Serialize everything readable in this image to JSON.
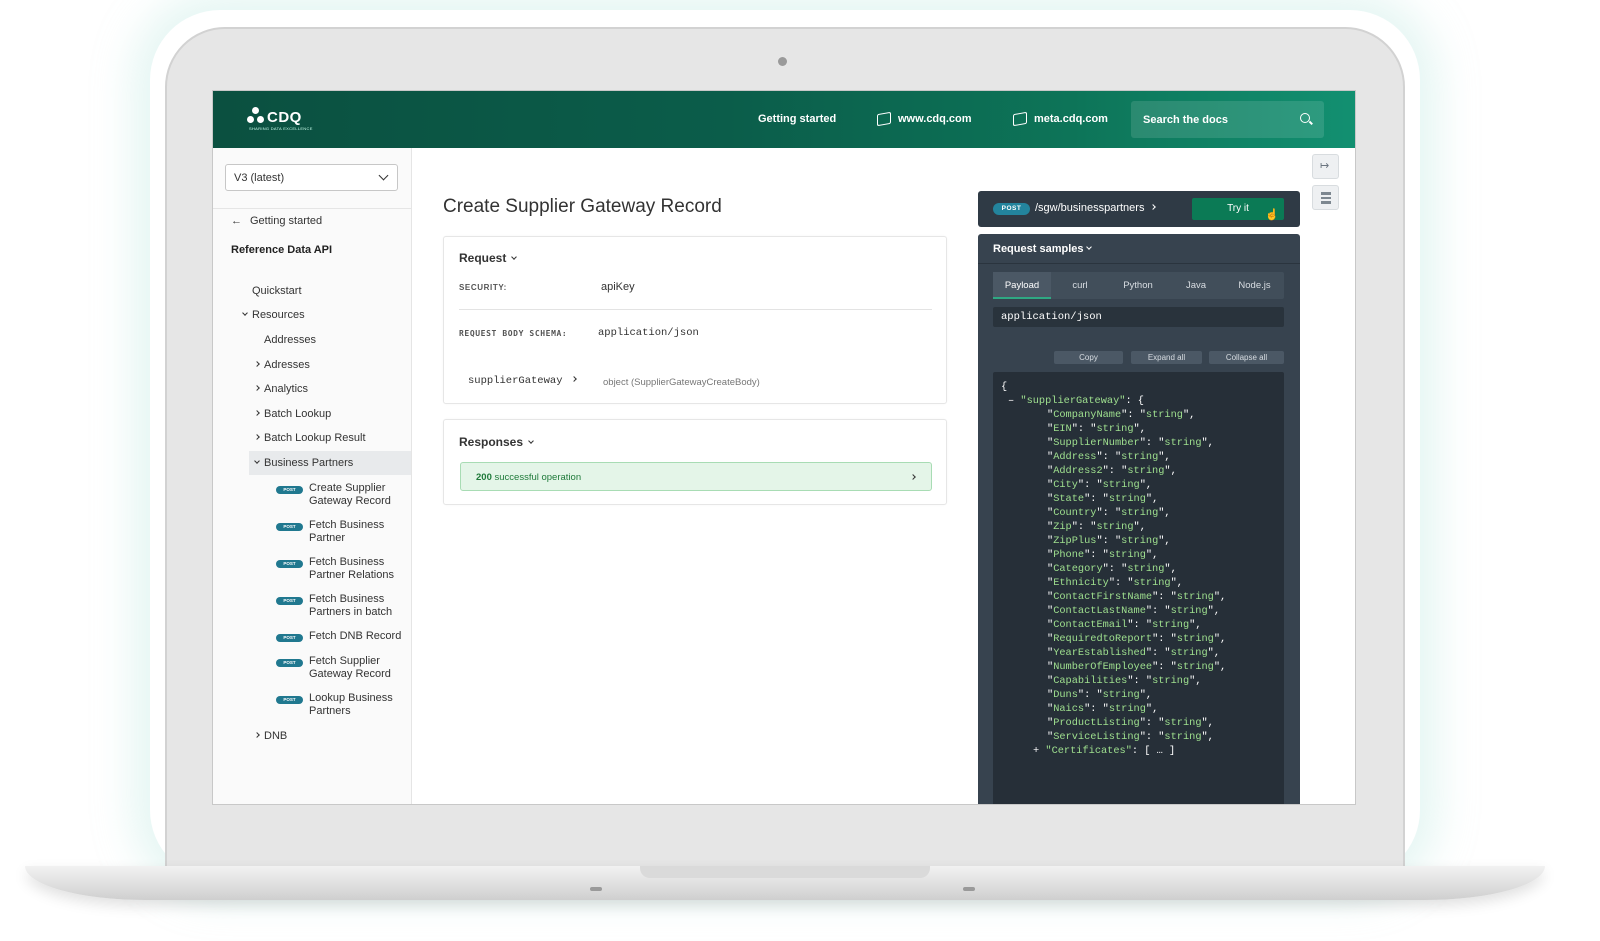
{
  "header": {
    "logo_text": "CDQ",
    "logo_tagline": "SHARING DATA EXCELLENCE",
    "nav": [
      "Getting started",
      "www.cdq.com",
      "meta.cdq.com"
    ],
    "search_placeholder": "Search the docs"
  },
  "sidebar": {
    "version": "V3 (latest)",
    "back_link": "Getting started",
    "section_title": "Reference Data API",
    "items": [
      "Quickstart",
      "Resources",
      "Addresses",
      "Adresses",
      "Analytics",
      "Batch Lookup",
      "Batch Lookup Result",
      "Business Partners",
      "DNB"
    ],
    "operations": [
      {
        "method": "POST",
        "label": "Create Supplier Gateway Record"
      },
      {
        "method": "POST",
        "label": "Fetch Business Partner"
      },
      {
        "method": "POST",
        "label": "Fetch Business Partner Relations"
      },
      {
        "method": "POST",
        "label": "Fetch Business Partners in batch"
      },
      {
        "method": "POST",
        "label": "Fetch DNB Record"
      },
      {
        "method": "POST",
        "label": "Fetch Supplier Gateway Record"
      },
      {
        "method": "POST",
        "label": "Lookup Business Partners"
      }
    ]
  },
  "main": {
    "title": "Create Supplier Gateway Record",
    "request": {
      "heading": "Request",
      "security_label": "SECURITY:",
      "security_value": "apiKey",
      "schema_label": "REQUEST BODY SCHEMA:",
      "schema_value": "application/json",
      "field_name": "supplierGateway",
      "field_type": "object (SupplierGatewayCreateBody)"
    },
    "responses": {
      "heading": "Responses",
      "code": "200",
      "description": "successful operation"
    }
  },
  "panel": {
    "method": "POST",
    "path": "/sgw/businesspartners",
    "try_label": "Try it",
    "samples_heading": "Request samples",
    "tabs": [
      "Payload",
      "curl",
      "Python",
      "Java",
      "Node.js"
    ],
    "active_tab": "Payload",
    "content_type": "application/json",
    "buttons": [
      "Copy",
      "Expand all",
      "Collapse all"
    ],
    "code": {
      "open_brace": "{",
      "collapse_toggle": "–",
      "root_key": "supplierGateway",
      "fields": [
        "CompanyName",
        "EIN",
        "SupplierNumber",
        "Address",
        "Address2",
        "City",
        "State",
        "Country",
        "Zip",
        "ZipPlus",
        "Phone",
        "Category",
        "Ethnicity",
        "ContactFirstName",
        "ContactLastName",
        "ContactEmail",
        "RequiredtoReport",
        "YearEstablished",
        "NumberOfEmployee",
        "Capabilities",
        "Duns",
        "Naics",
        "ProductListing",
        "ServiceListing"
      ],
      "field_value": "string",
      "expand_toggle": "+",
      "collapsed_key": "Certificates",
      "collapsed_value": "[ … ]"
    }
  }
}
